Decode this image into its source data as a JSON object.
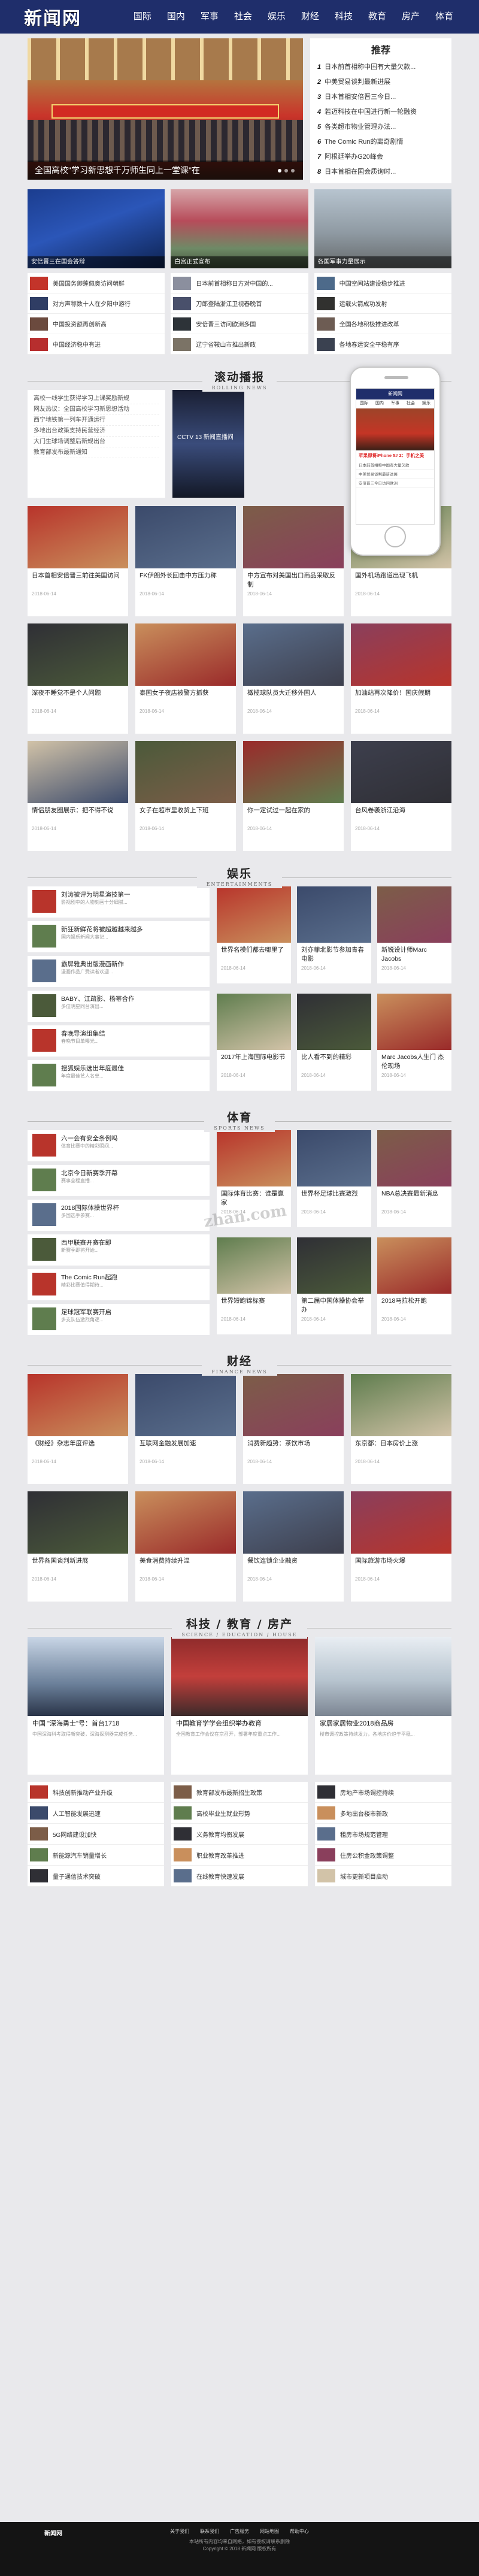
{
  "header": {
    "logo": "新闻网",
    "nav": [
      "国际",
      "国内",
      "军事",
      "社会",
      "娱乐",
      "财经",
      "科技",
      "教育",
      "房产",
      "体育"
    ]
  },
  "hero": {
    "caption": "全国高校\"学习新思想千万师生同上一堂课\"在"
  },
  "recommend": {
    "title": "推荐",
    "items": [
      {
        "n": "1",
        "t": "日本前首相称中国有大量欠款..."
      },
      {
        "n": "2",
        "t": "中美贸易谈判最新进展"
      },
      {
        "n": "3",
        "t": "日本首相安倍晋三今日..."
      },
      {
        "n": "4",
        "t": "若迈科技在中国进行新一轮融资"
      },
      {
        "n": "5",
        "t": "各类超市物业管理办法..."
      },
      {
        "n": "6",
        "t": "The Comic Run的离奇剧情"
      },
      {
        "n": "7",
        "t": "阿根廷举办G20峰会"
      },
      {
        "n": "8",
        "t": "日本首相在国会质询时..."
      }
    ]
  },
  "pics": [
    {
      "cap": "安倍晋三在国会答辩"
    },
    {
      "cap": "白宫正式宣布"
    },
    {
      "cap": "各国军事力量展示"
    }
  ],
  "rows_top": [
    [
      "美国国务卿蓬佩奥访问朝鲜",
      "对方声称数十人在夕阳中游行",
      "中国投资额再创新高",
      "中国经济稳中有进"
    ],
    [
      "日本前首相称日方对中国的...",
      "刀郎登陆浙江卫视春晚首",
      "安倍晋三访问欧洲多国",
      "辽宁省鞍山市推出新政"
    ],
    [
      "中国空间站建设稳步推进",
      "运载火箭成功发射",
      "全国各地积极推进改革",
      "各地春运安全平稳有序"
    ]
  ],
  "scroll": {
    "title": "滚动播报",
    "en": "ROLLING NEWS",
    "items": [
      "高校一线学生获得学习上课奖励新规",
      "网友热议：全国高校学习新思想活动",
      "西宁地铁第一列车开通运行",
      "多地出台政策支持民营经济",
      "大门生球场调整后新规出台",
      "教育部发布最新通知"
    ],
    "media_caption": "CCTV 13 新闻直播间"
  },
  "phone": {
    "title": "新闻网",
    "tabs": [
      "国际",
      "国内",
      "军事",
      "社会",
      "娱乐"
    ],
    "headline": "苹果即将iPhone 5# 2：手机之美",
    "list": [
      "日本前首相称中国有大量欠款",
      "中美贸易谈判最新进展",
      "安倍晋三今日访问欧洲"
    ]
  },
  "scroll_grid": [
    {
      "t": "日本首相安倍晋三前往美国访问",
      "d": "2018-06-14"
    },
    {
      "t": "FK伊朗外长回击中方压力称",
      "d": "2018-06-14"
    },
    {
      "t": "中方宣布对美国出口商品采取反制",
      "d": "2018-06-14"
    },
    {
      "t": "国外机场跑道出现飞机",
      "d": "2018-06-14"
    },
    {
      "t": "深夜不睡觉不是个人问题",
      "d": "2018-06-14"
    },
    {
      "t": "泰国女子夜店被警方抓获",
      "d": "2018-06-14"
    },
    {
      "t": "橄榄球队员大迁移外国人",
      "d": "2018-06-14"
    },
    {
      "t": "加油站再次降价！国庆假期",
      "d": "2018-06-14"
    },
    {
      "t": "情侣朋友圈展示：把不得不说",
      "d": "2018-06-14"
    },
    {
      "t": "女子在超市里收货上下班",
      "d": "2018-06-14"
    },
    {
      "t": "你一定试过一起在家的",
      "d": "2018-06-14"
    },
    {
      "t": "台风卷袭浙江沿海",
      "d": "2018-06-14"
    }
  ],
  "ent": {
    "title": "娱乐",
    "en": "ENTERTAINMENTS",
    "list": [
      {
        "t": "刘涛被评为明星演技第一",
        "d": "影视剧中的人物刻画十分细腻..."
      },
      {
        "t": "新狂新鲜花将被超越越来越多",
        "d": "国内娱乐新闻大事记..."
      },
      {
        "t": "霸屏雅典出版漫画新作",
        "d": "漫画作品广受读者欢迎..."
      },
      {
        "t": "BABY、江疏影、杨幂合作",
        "d": "多位明星同台演出..."
      },
      {
        "t": "春晚导演组集结",
        "d": "春晚节目单曝光..."
      },
      {
        "t": "搜狐娱乐选出年度最佳",
        "d": "年度最佳艺人名单..."
      }
    ],
    "grid": [
      {
        "t": "世界名模们都去哪里了",
        "d": "2018-06-14"
      },
      {
        "t": "刘亦菲北影节参加青春电影",
        "d": "2018-06-14"
      },
      {
        "t": "新锐设计师Marc Jacobs",
        "d": "2018-06-14"
      },
      {
        "t": "2017年上海国际电影节",
        "d": "2018-06-14"
      },
      {
        "t": "比人看不到的精彩",
        "d": "2018-06-14"
      },
      {
        "t": "Marc Jacobs人生门 杰伦现场",
        "d": "2018-06-14"
      }
    ]
  },
  "sport": {
    "title": "体育",
    "en": "SPORTS NEWS",
    "list": [
      {
        "t": "六一会有安全条例吗",
        "d": "体育比赛中的精彩瞬间..."
      },
      {
        "t": "北京今日新赛季开幕",
        "d": "赛事全程直播..."
      },
      {
        "t": "2018国际体操世界杯",
        "d": "多国选手参赛..."
      },
      {
        "t": "西甲联赛开赛在即",
        "d": "新赛季即将开始..."
      },
      {
        "t": "The Comic Run起跑",
        "d": "精彩比赛值得期待..."
      },
      {
        "t": "足球冠军联赛开启",
        "d": "多支队伍激烈角逐..."
      }
    ],
    "grid": [
      {
        "t": "国际体育比赛：谁是赢家",
        "d": "2018-06-14"
      },
      {
        "t": "世界杯足球比赛激烈",
        "d": "2018-06-14"
      },
      {
        "t": "NBA总决赛最新消息",
        "d": "2018-06-14"
      },
      {
        "t": "世界短跑锦标赛",
        "d": "2018-06-14"
      },
      {
        "t": "第二届中国体操协会举办",
        "d": "2018-06-14"
      },
      {
        "t": "2018马拉松开跑",
        "d": "2018-06-14"
      }
    ]
  },
  "finance": {
    "title": "财经",
    "en": "FINANCE NEWS",
    "grid": [
      {
        "t": "《财经》杂志年度评选",
        "d": "2018-06-14"
      },
      {
        "t": "互联网金融发展加速",
        "d": "2018-06-14"
      },
      {
        "t": "消费新趋势：茶饮市场",
        "d": "2018-06-14"
      },
      {
        "t": "东京都：日本房价上涨",
        "d": "2018-06-14"
      },
      {
        "t": "世界各国谈判新进展",
        "d": "2018-06-14"
      },
      {
        "t": "美食消费持续升温",
        "d": "2018-06-14"
      },
      {
        "t": "餐饮连锁企业融资",
        "d": "2018-06-14"
      },
      {
        "t": "国际旅游市场火爆",
        "d": "2018-06-14"
      }
    ]
  },
  "tech": {
    "title": "科技 / 教育 / 房产",
    "en": "SCIENCE / EDUCATION / HOUSE",
    "cards": [
      {
        "t": "中国 \"深海勇士\"号：首台1718",
        "d": "中国深海科考取得新突破，深海探测器完成任务..."
      },
      {
        "t": "中国教育学学会组织举办教育",
        "d": "全国教育工作会议在京召开，部署年度重点工作..."
      },
      {
        "t": "家居家居物业2018商品房",
        "d": "楼市调控政策持续发力，各地房价趋于平稳..."
      }
    ],
    "list": [
      [
        "科技创新推动产业升级",
        "教育部发布最新招生政策",
        "房地产市场调控持续"
      ],
      [
        "人工智能发展迅速",
        "高校毕业生就业形势",
        "多地出台楼市新政"
      ],
      [
        "5G网络建设加快",
        "义务教育均衡发展",
        "租房市场规范管理"
      ],
      [
        "新能源汽车销量增长",
        "职业教育改革推进",
        "住房公积金政策调整"
      ],
      [
        "量子通信技术突破",
        "在线教育快速发展",
        "城市更新项目启动"
      ]
    ]
  },
  "footer": {
    "logo": "新闻网",
    "links": [
      "关于我们",
      "联系我们",
      "广告服务",
      "网站地图",
      "帮助中心"
    ],
    "copy1": "本站所有内容均来自网络，如有侵权请联系删除",
    "copy2": "Copyright © 2018 新闻网 版权所有"
  },
  "watermark": "zhan.com"
}
